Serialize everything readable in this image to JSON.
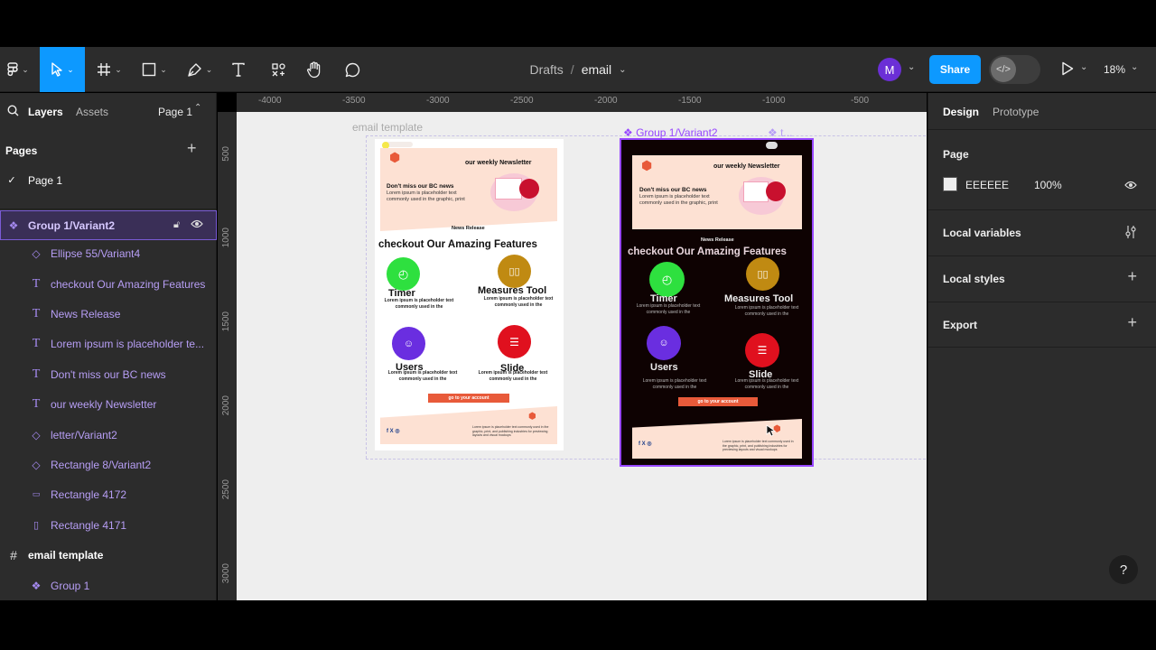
{
  "toolbar": {
    "breadcrumb_parent": "Drafts",
    "breadcrumb_sep": "/",
    "file_name": "email",
    "avatar_initial": "M",
    "share_label": "Share",
    "zoom": "18%"
  },
  "left_panel": {
    "tab_layers": "Layers",
    "tab_assets": "Assets",
    "page_selector": "Page 1",
    "pages_title": "Pages",
    "pages": [
      "Page 1"
    ],
    "layers": [
      {
        "label": "Group 1/Variant2",
        "icon": "component-icon"
      },
      {
        "label": "Ellipse 55/Variant4",
        "icon": "instance-icon"
      },
      {
        "label": "checkout Our Amazing Features",
        "icon": "text-icon"
      },
      {
        "label": "News Release",
        "icon": "text-icon"
      },
      {
        "label": "Lorem ipsum is placeholder te...",
        "icon": "text-icon"
      },
      {
        "label": "Don't miss our BC news",
        "icon": "text-icon"
      },
      {
        "label": "our weekly Newsletter",
        "icon": "text-icon"
      },
      {
        "label": "letter/Variant2",
        "icon": "instance-icon"
      },
      {
        "label": "Rectangle 8/Variant2",
        "icon": "instance-icon"
      },
      {
        "label": "Rectangle 4172",
        "icon": "rectangle-icon"
      },
      {
        "label": "Rectangle 4171",
        "icon": "rectangle-icon"
      },
      {
        "label": "email template",
        "icon": "frame-icon"
      },
      {
        "label": "Group 1",
        "icon": "component-icon"
      }
    ]
  },
  "rulers": {
    "top": [
      "-4000",
      "-3500",
      "-3000",
      "-2500",
      "-2000",
      "-1500",
      "-1000",
      "-500"
    ],
    "left": [
      "500",
      "1000",
      "1500",
      "2000",
      "2500",
      "3000"
    ]
  },
  "canvas": {
    "frame_label_left": "email template",
    "frame_label_right": "Group 1/Variant2",
    "frame_label_right_extra": "t...",
    "email": {
      "newsletter": "our weekly Newsletter",
      "dont_miss": "Don't miss our BC  news",
      "lorem_intro": "Lorem ipsum is placeholder text commonly used in the graphic, print",
      "news_release": "News Release",
      "features_title": "checkout Our Amazing Features",
      "feature_timer": "Timer",
      "feature_measures": "Measures Tool",
      "feature_users": "Users",
      "feature_slide": "Slide",
      "feature_desc": "Lorem ipsum is placeholder text commonly used in the",
      "cta": "go to your account",
      "footer_text": "Lorem ipsum is placeholder text commonly used in the graphic, print, and publishing industries for previewing layouts and visual mockups",
      "social": "f X ◎"
    }
  },
  "right_panel": {
    "tab_design": "Design",
    "tab_prototype": "Prototype",
    "page_title": "Page",
    "page_color": "EEEEEE",
    "page_opacity": "100%",
    "local_variables": "Local variables",
    "local_styles": "Local styles",
    "export": "Export",
    "help": "?"
  },
  "colors": {
    "accent": "#0d99ff",
    "component_purple": "#9747ff",
    "timer_green": "#2ee03f",
    "measures_gold": "#c08a12",
    "users_purple": "#6a2ee0",
    "slide_red": "#e0101e",
    "cta_orange": "#e85a3a",
    "peach": "#fde1d3"
  }
}
